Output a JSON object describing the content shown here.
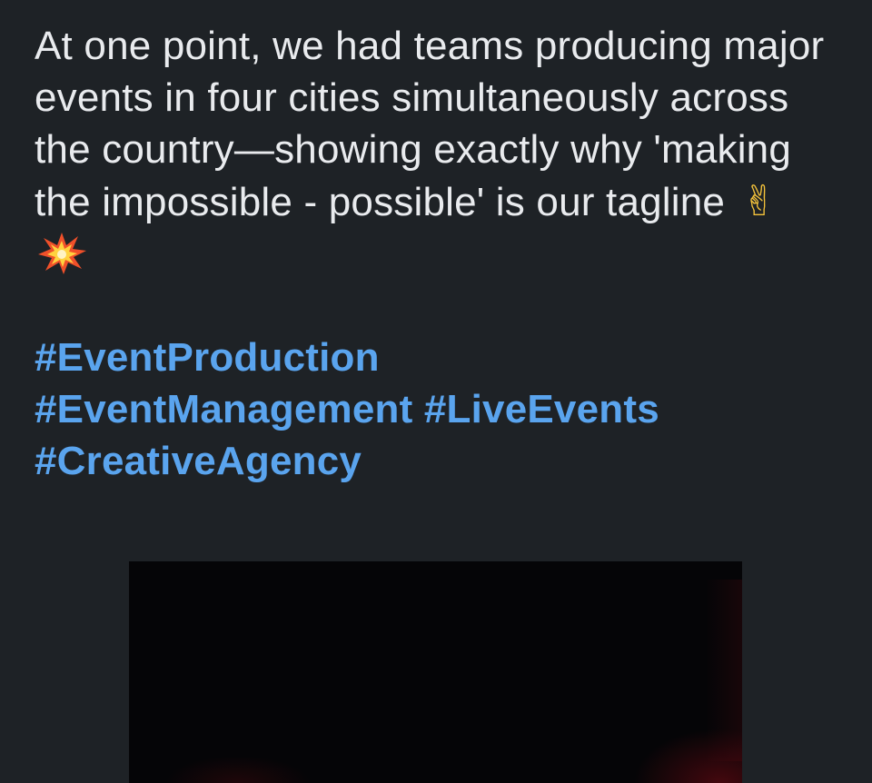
{
  "post": {
    "text": "At one point, we had teams producing major events in four cities simultaneously across the country—showing exactly why 'making the impossible - possible' is our tagline",
    "emojis": {
      "peace": "✌",
      "collision": "collision-icon"
    },
    "hashtags": [
      "#EventProduction",
      "#EventManagement",
      "#LiveEvents",
      "#CreativeAgency"
    ]
  },
  "media": {
    "type": "video-thumbnail"
  },
  "colors": {
    "background": "#1e2226",
    "text": "#e9ebee",
    "hashtag": "#5aa4ee",
    "media_bg": "#050507"
  }
}
